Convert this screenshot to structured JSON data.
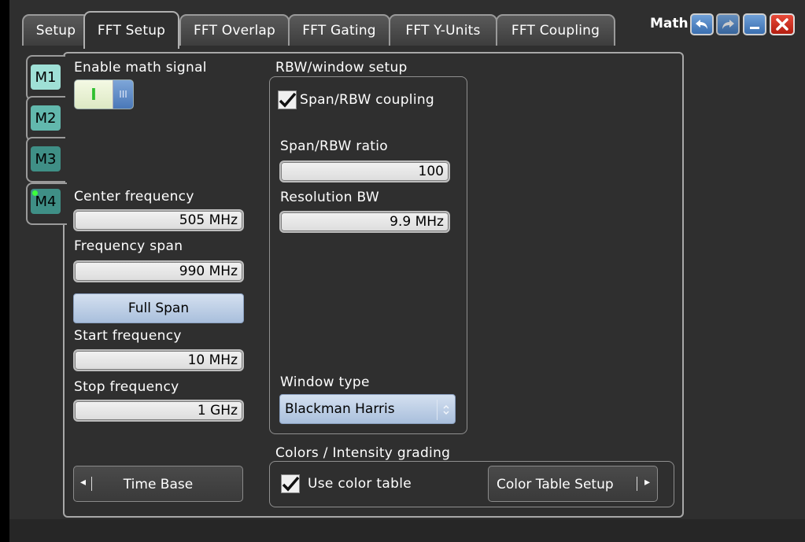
{
  "tabs": [
    {
      "label": "Setup"
    },
    {
      "label": "FFT Setup"
    },
    {
      "label": "FFT Overlap"
    },
    {
      "label": "FFT Gating"
    },
    {
      "label": "FFT Y-Units"
    },
    {
      "label": "FFT Coupling"
    }
  ],
  "active_tab": "FFT Setup",
  "window": {
    "title": "Math",
    "icons": [
      "undo-icon",
      "redo-icon",
      "minimize-icon",
      "close-icon"
    ]
  },
  "math_tabs": [
    {
      "label": "M1",
      "color": "#9fe0d6"
    },
    {
      "label": "M2",
      "color": "#62b8ad"
    },
    {
      "label": "M3",
      "color": "#3f8f86"
    },
    {
      "label": "M4",
      "color": "#3f8f86"
    }
  ],
  "active_math": "M4",
  "enable": {
    "label": "Enable math signal",
    "on_label": "I",
    "off_label": "III",
    "state": "on"
  },
  "center_frequency": {
    "label": "Center frequency",
    "value": "505 MHz"
  },
  "frequency_span": {
    "label": "Frequency span",
    "value": "990 MHz"
  },
  "full_span": {
    "label": "Full Span"
  },
  "start_frequency": {
    "label": "Start frequency",
    "value": "10 MHz"
  },
  "stop_frequency": {
    "label": "Stop frequency",
    "value": "1 GHz"
  },
  "time_base": {
    "label": "Time Base",
    "arrow": "◂"
  },
  "rbw": {
    "title": "RBW/window setup",
    "coupling_label": "Span/RBW coupling",
    "coupling_checked": true,
    "ratio_label": "Span/RBW ratio",
    "ratio_value": "100",
    "resolution_label": "Resolution BW",
    "resolution_value": "9.9 MHz",
    "window_label": "Window type",
    "window_value": "Blackman Harris"
  },
  "colors": {
    "title": "Colors / Intensity grading",
    "use_label": "Use color table",
    "use_checked": true,
    "setup_label": "Color Table Setup",
    "arrow": "▸"
  }
}
